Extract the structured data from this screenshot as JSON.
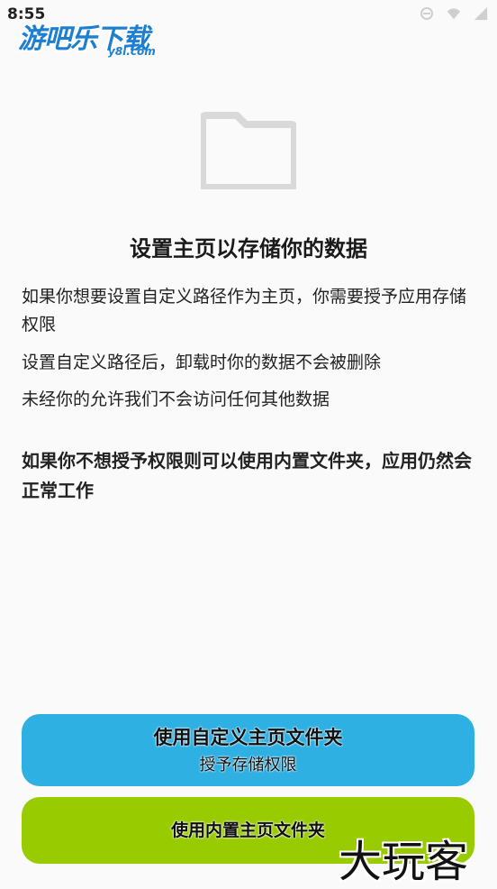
{
  "status_bar": {
    "time": "8:55"
  },
  "watermark_top": {
    "main": "游吧乐下载",
    "sub": "y8l.com"
  },
  "content": {
    "title": "设置主页以存储你的数据",
    "para1": "如果你想要设置自定义路径作为主页，你需要授予应用存储权限",
    "para2": "设置自定义路径后，卸载时你的数据不会被删除",
    "para3": "未经你的允许我们不会访问任何其他数据",
    "para4": "如果你不想授予权限则可以使用内置文件夹，应用仍然会正常工作"
  },
  "buttons": {
    "custom_label": "使用自定义主页文件夹",
    "custom_sub": "授予存储权限",
    "builtin_label": "使用内置主页文件夹"
  },
  "watermark_br": "大玩客",
  "colors": {
    "custom_button": "#2eb0e2",
    "builtin_button": "#99cc00",
    "folder_icon": "#d9d9d9"
  },
  "icons": [
    "dnd-icon",
    "wifi-icon",
    "signal-icon",
    "folder-icon"
  ]
}
